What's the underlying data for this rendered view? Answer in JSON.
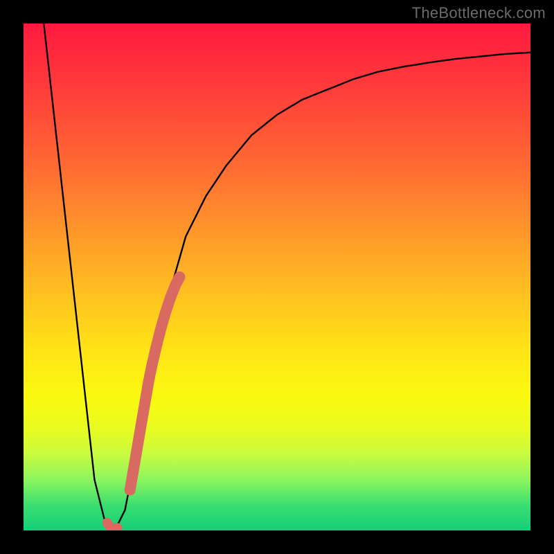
{
  "watermark": "TheBottleneck.com",
  "chart_data": {
    "type": "line",
    "title": "",
    "xlabel": "",
    "ylabel": "",
    "xlim": [
      0,
      100
    ],
    "ylim": [
      0,
      100
    ],
    "series": [
      {
        "name": "bottleneck-curve",
        "x": [
          4,
          6,
          8,
          10,
          12,
          14,
          16,
          18,
          20,
          22,
          25,
          28,
          32,
          36,
          40,
          45,
          50,
          55,
          60,
          65,
          70,
          75,
          80,
          85,
          90,
          95,
          100
        ],
        "y": [
          100,
          82,
          64,
          46,
          28,
          10,
          2,
          0,
          4,
          14,
          30,
          44,
          58,
          66,
          72,
          78,
          82,
          85,
          87,
          89,
          90.5,
          91.5,
          92.3,
          93,
          93.5,
          94,
          94.3
        ]
      },
      {
        "name": "bottleneck-marker-segment",
        "x": [
          21.0,
          21.6,
          22.2,
          22.8,
          23.4,
          24.0,
          24.6,
          25.2,
          26.0,
          27.0,
          28.0,
          29.0,
          30.0,
          30.8
        ],
        "y": [
          8.0,
          11.5,
          15.0,
          18.5,
          22.0,
          25.5,
          29.0,
          32.0,
          35.5,
          39.5,
          43.0,
          46.0,
          48.5,
          50.0
        ]
      },
      {
        "name": "bottleneck-marker-tip",
        "x": [
          16.5,
          17.0,
          17.5,
          18.0,
          18.5
        ],
        "y": [
          1.5,
          0.8,
          0.4,
          0.2,
          0.5
        ]
      }
    ],
    "annotations": []
  }
}
